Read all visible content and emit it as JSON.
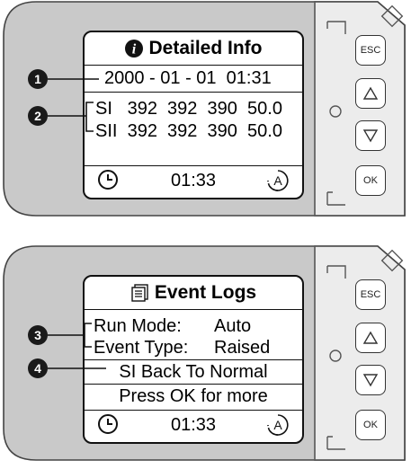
{
  "panel1": {
    "title": "Detailed Info",
    "datetime": "2000 - 01 - 01  01:31",
    "row1": "SI   392  392  390  50.0",
    "row2": "SII  392  392  390  50.0",
    "time": "01:33",
    "callouts": [
      "1",
      "2"
    ]
  },
  "panel2": {
    "title": "Event Logs",
    "run_mode_label": "Run Mode:",
    "run_mode_value": "Auto",
    "event_type_label": "Event Type:",
    "event_type_value": "Raised",
    "event_text": "SI Back To Normal",
    "more_text": "Press OK for more",
    "time": "01:33",
    "callouts": [
      "3",
      "4"
    ]
  },
  "buttons": {
    "esc": "ESC",
    "ok": "OK"
  },
  "icons": {
    "info": "info-icon",
    "log": "document-icon",
    "clock": "clock-icon",
    "auto": "auto-mode-icon"
  },
  "colors": {
    "housing": "#c9c9c9",
    "side_panel": "#ececec",
    "screen": "#ffffff",
    "outline": "#111111"
  }
}
